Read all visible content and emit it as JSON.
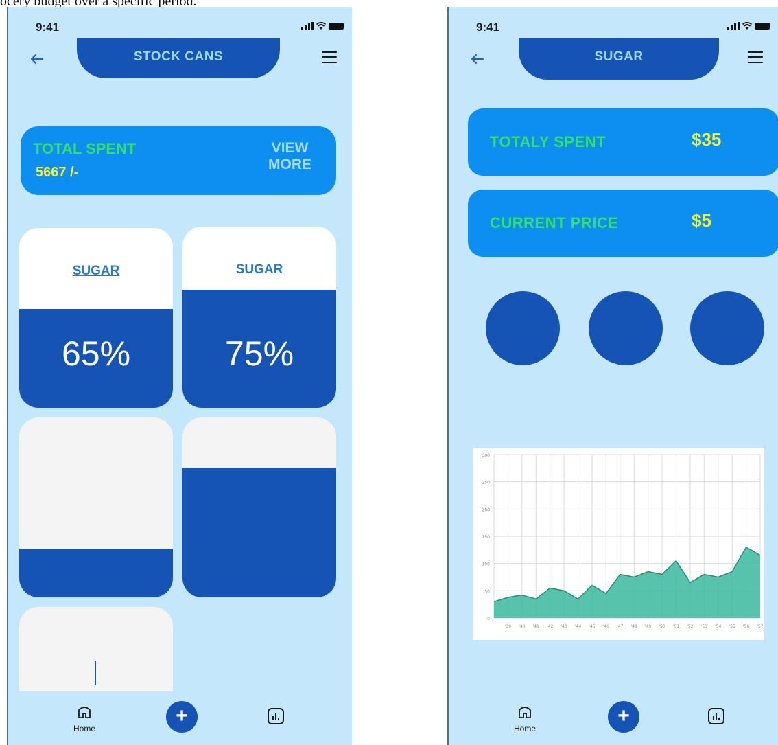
{
  "caption": "ocery budget over a specific period.",
  "left_screen": {
    "status_time": "9:41",
    "title": "STOCK CANS",
    "total_card": {
      "label": "TOTAL SPENT",
      "value": "5667 /-",
      "view_more_line1": "VIEW",
      "view_more_line2": "MORE"
    },
    "cans": [
      {
        "label": "SUGAR",
        "percent_text": "65%",
        "fill_fraction": 0.55
      },
      {
        "label": "SUGAR",
        "percent_text": "75%",
        "fill_fraction": 0.65
      },
      {
        "label": "",
        "percent_text": "",
        "fill_fraction": 0.27
      },
      {
        "label": "",
        "percent_text": "",
        "fill_fraction": 0.72
      }
    ],
    "nav": {
      "home_label": "Home",
      "plus_label": "+"
    }
  },
  "right_screen": {
    "status_time": "9:41",
    "title": "SUGAR",
    "spent_card": {
      "label": "TOTALY SPENT",
      "value": "$35"
    },
    "price_card": {
      "label": "CURRENT PRICE",
      "value": "$5"
    },
    "nav": {
      "home_label": "Home",
      "plus_label": "+"
    }
  },
  "colors": {
    "background": "#c4e7fb",
    "primary_dark": "#1554b4",
    "card_blue": "#0c8ff0",
    "label_green": "#35e06a",
    "value_yellow": "#f2f23a",
    "area_fill": "#3bb89e"
  },
  "chart_data": {
    "type": "area",
    "x": [
      "'39",
      "'40",
      "'41",
      "'42",
      "'43",
      "'44",
      "'45",
      "'46",
      "'47",
      "'48",
      "'49",
      "'50",
      "'51",
      "'52",
      "'53",
      "'54",
      "'55",
      "'56",
      "'57"
    ],
    "values": [
      30,
      38,
      42,
      35,
      55,
      50,
      35,
      60,
      45,
      80,
      75,
      85,
      80,
      105,
      65,
      80,
      75,
      85,
      130,
      115
    ],
    "ylim": [
      0,
      300
    ],
    "yticks": [
      0,
      50,
      100,
      150,
      200,
      250,
      300
    ],
    "grid": true,
    "title": "",
    "xlabel": "",
    "ylabel": ""
  }
}
